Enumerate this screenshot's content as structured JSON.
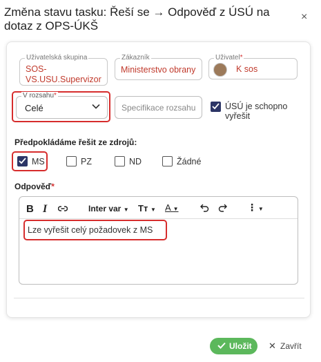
{
  "dialog": {
    "title": "Změna stavu tasku: Řeší se → Odpověď z ÚSÚ na dotaz z OPS-ÚKŠ",
    "close_icon": "×"
  },
  "fields": {
    "user_group": {
      "label": "Uživatelská skupina",
      "value": "SOS-VS.USU.Supervizor"
    },
    "customer": {
      "label": "Zákazník",
      "value": "Ministerstvo obrany"
    },
    "user": {
      "label": "Uživatel",
      "required": "*",
      "value": "K sos"
    },
    "scope": {
      "label": "V rozsahu",
      "required": "*",
      "value": "Celé"
    },
    "scope_spec": {
      "placeholder": "Specifikace rozsahu"
    },
    "usu_can_solve": {
      "label": "ÚSÚ je schopno vyřešit",
      "checked": true
    }
  },
  "resources": {
    "heading": "Předpokládáme řešit ze zdrojů:",
    "options": [
      {
        "label": "MS",
        "checked": true
      },
      {
        "label": "PZ",
        "checked": false
      },
      {
        "label": "ND",
        "checked": false
      },
      {
        "label": "Žádné",
        "checked": false
      }
    ]
  },
  "answer": {
    "heading": "Odpověď",
    "required": "*",
    "toolbar": {
      "bold": "B",
      "italic": "I",
      "font": "Inter var",
      "text_size_icon": "Tт",
      "font_color_icon": "A"
    },
    "text": "Lze vyřešit celý požadovek z MS"
  },
  "footer": {
    "save_label": "Uložit",
    "close_label": "Zavřít",
    "save_color": "#5cb85c"
  },
  "highlight_color": "#d62c2c"
}
